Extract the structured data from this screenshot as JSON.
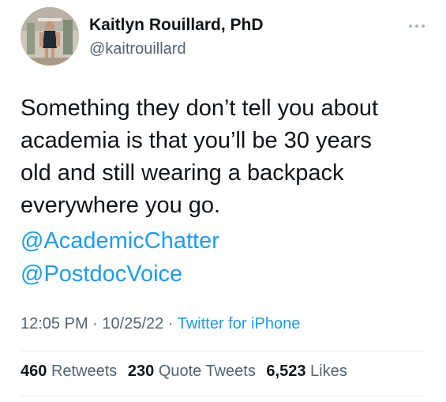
{
  "tweet": {
    "author": {
      "display_name": "Kaitlyn Rouillard, PhD",
      "handle": "@kaitrouillard"
    },
    "body_lines": [
      "Something they don’t tell you about",
      "academia is that you’ll be 30 years",
      "old and still wearing a backpack",
      "everywhere you go."
    ],
    "mentions": [
      "@AcademicChatter",
      "@PostdocVoice"
    ],
    "meta": {
      "time": "12:05 PM",
      "date": "10/25/22",
      "separator": "·",
      "source": "Twitter for iPhone"
    },
    "stats": {
      "retweets_count": "460",
      "retweets_label": "Retweets",
      "quotes_count": "230",
      "quotes_label": "Quote Tweets",
      "likes_count": "6,523",
      "likes_label": "Likes"
    }
  },
  "icons": {
    "more": "more-options-icon"
  },
  "colors": {
    "text": "#0f1419",
    "secondary": "#536471",
    "link": "#1d9bf0",
    "divider": "#e6ecf0"
  }
}
